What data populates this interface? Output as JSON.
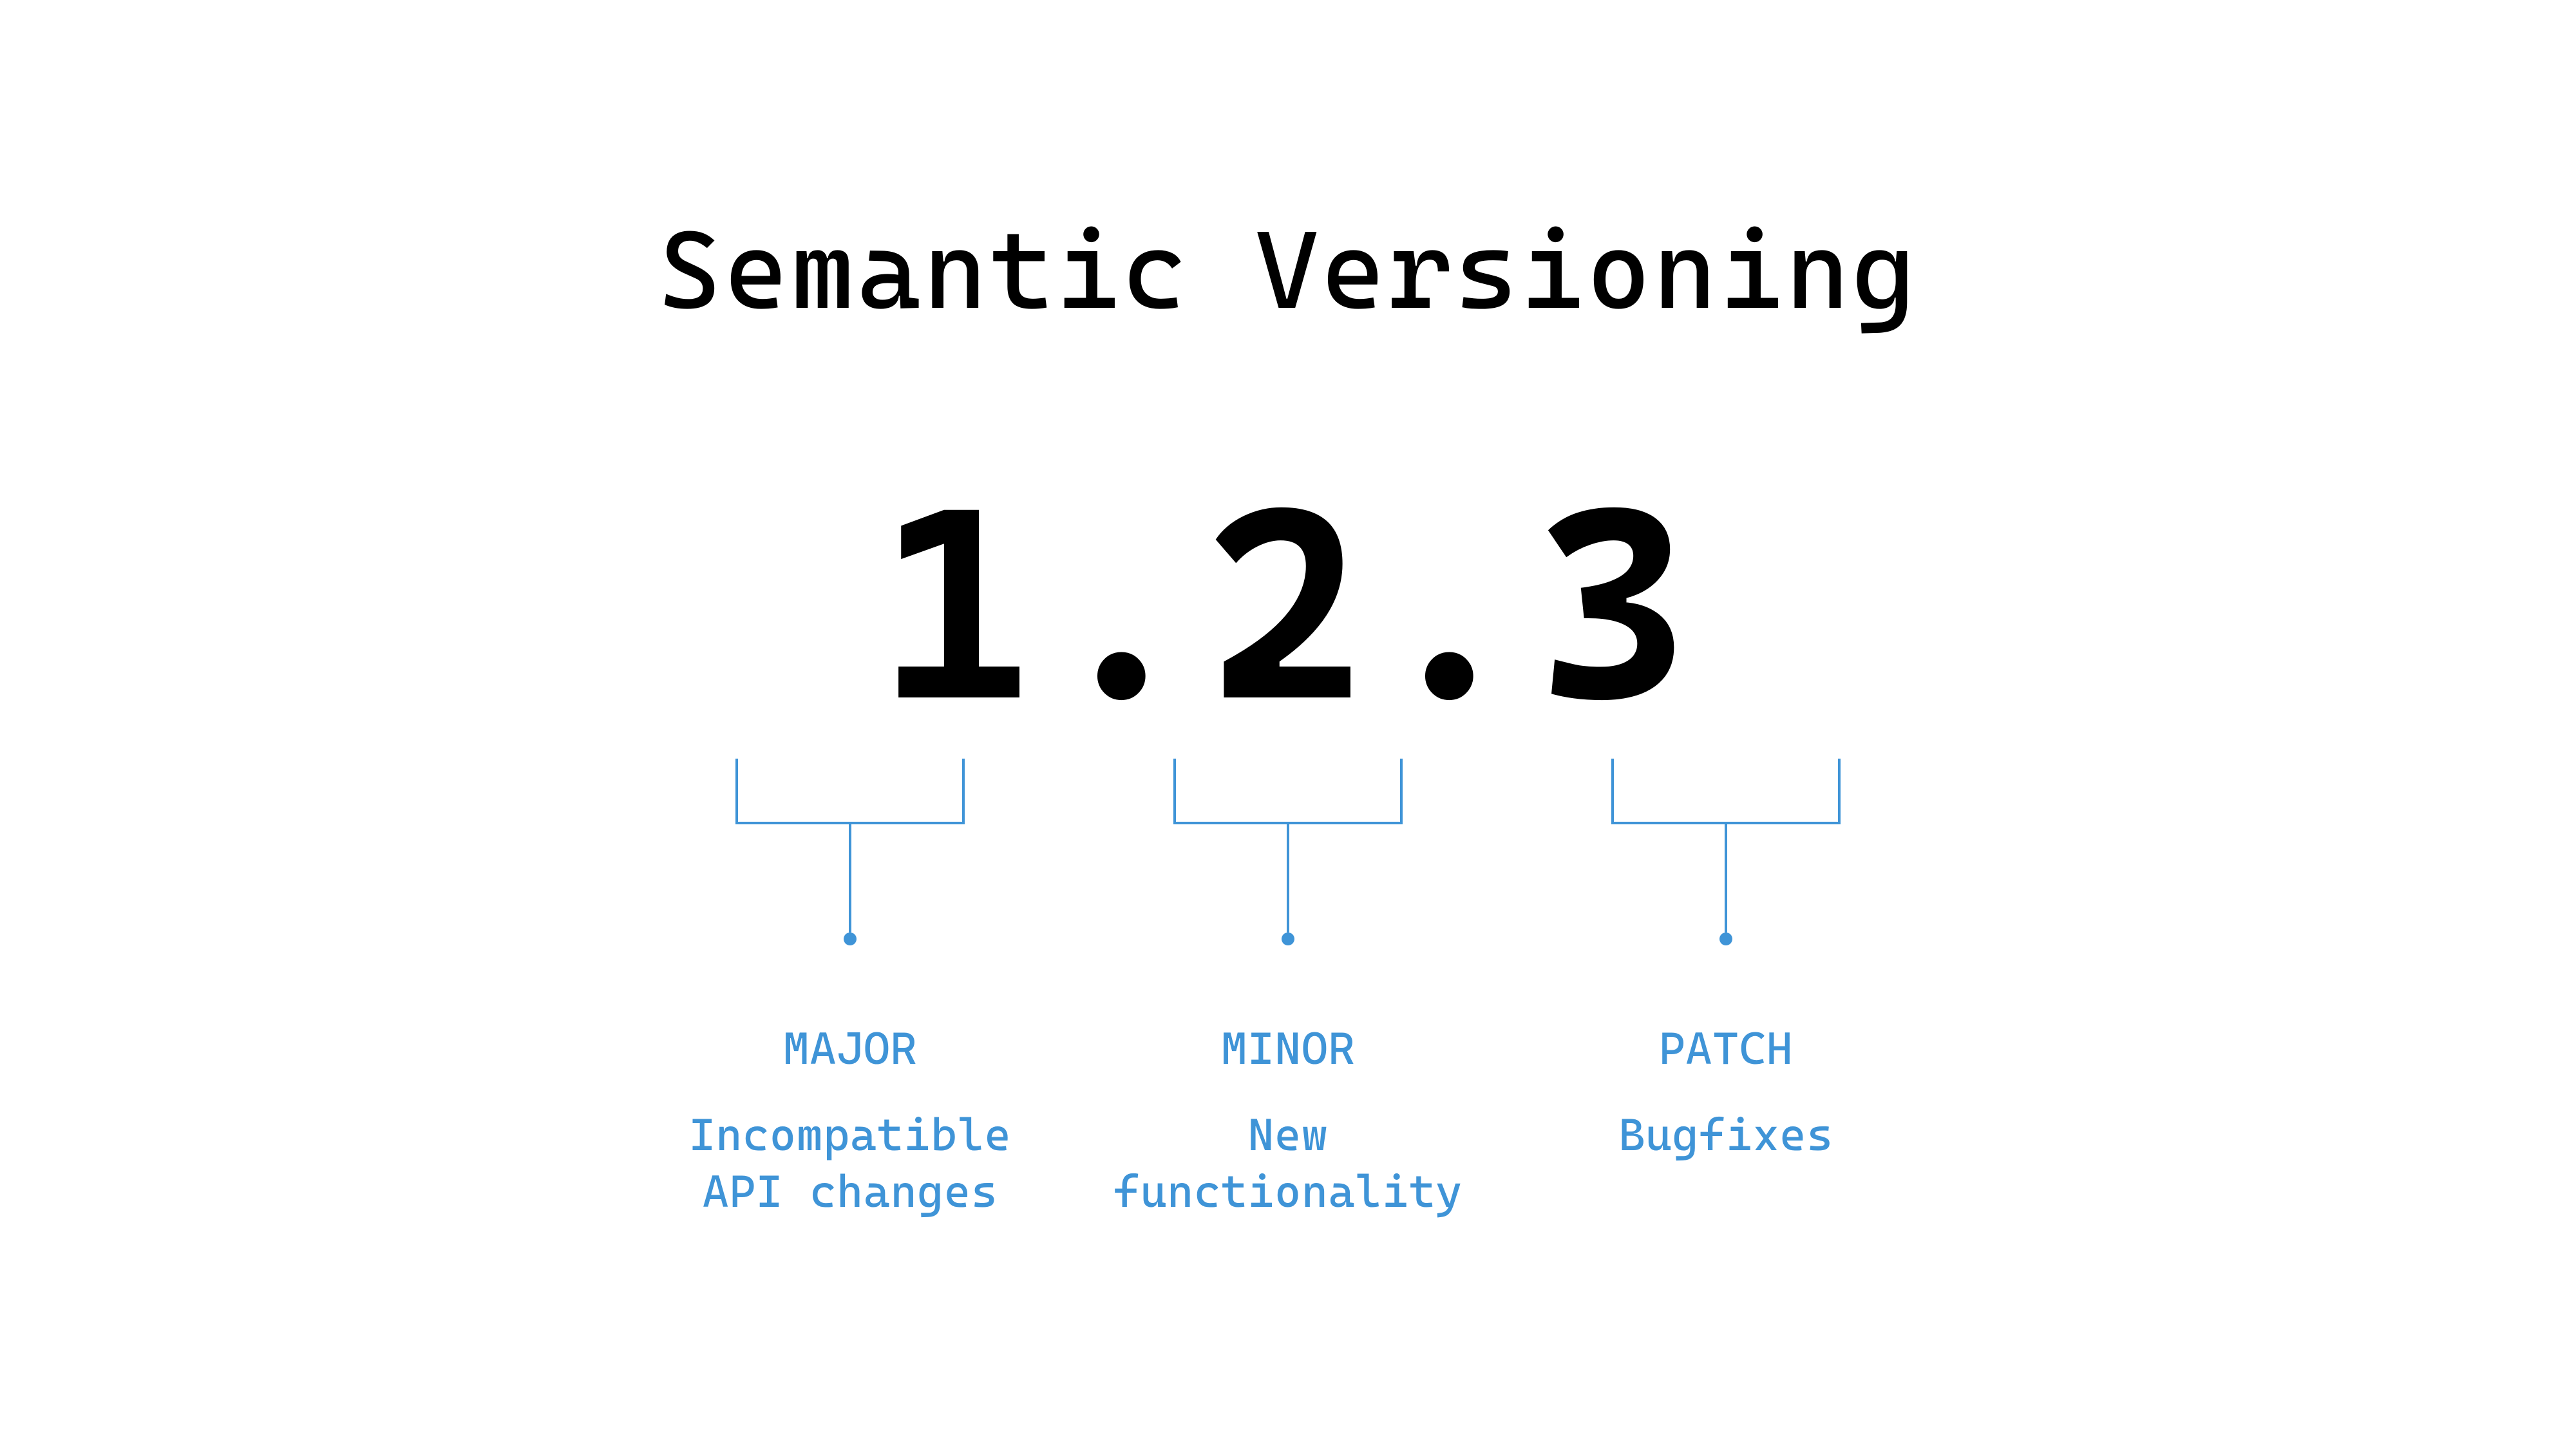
{
  "title": "Semantic Versioning",
  "version": {
    "major": "1",
    "sep1": ".",
    "minor": "2",
    "sep2": ".",
    "patch": "3"
  },
  "segments": {
    "major": {
      "label": "MAJOR",
      "desc": "Incompatible API changes"
    },
    "minor": {
      "label": "MINOR",
      "desc": "New functionality"
    },
    "patch": {
      "label": "PATCH",
      "desc": "Bugfixes"
    }
  },
  "colors": {
    "accent": "#3f94d7"
  }
}
